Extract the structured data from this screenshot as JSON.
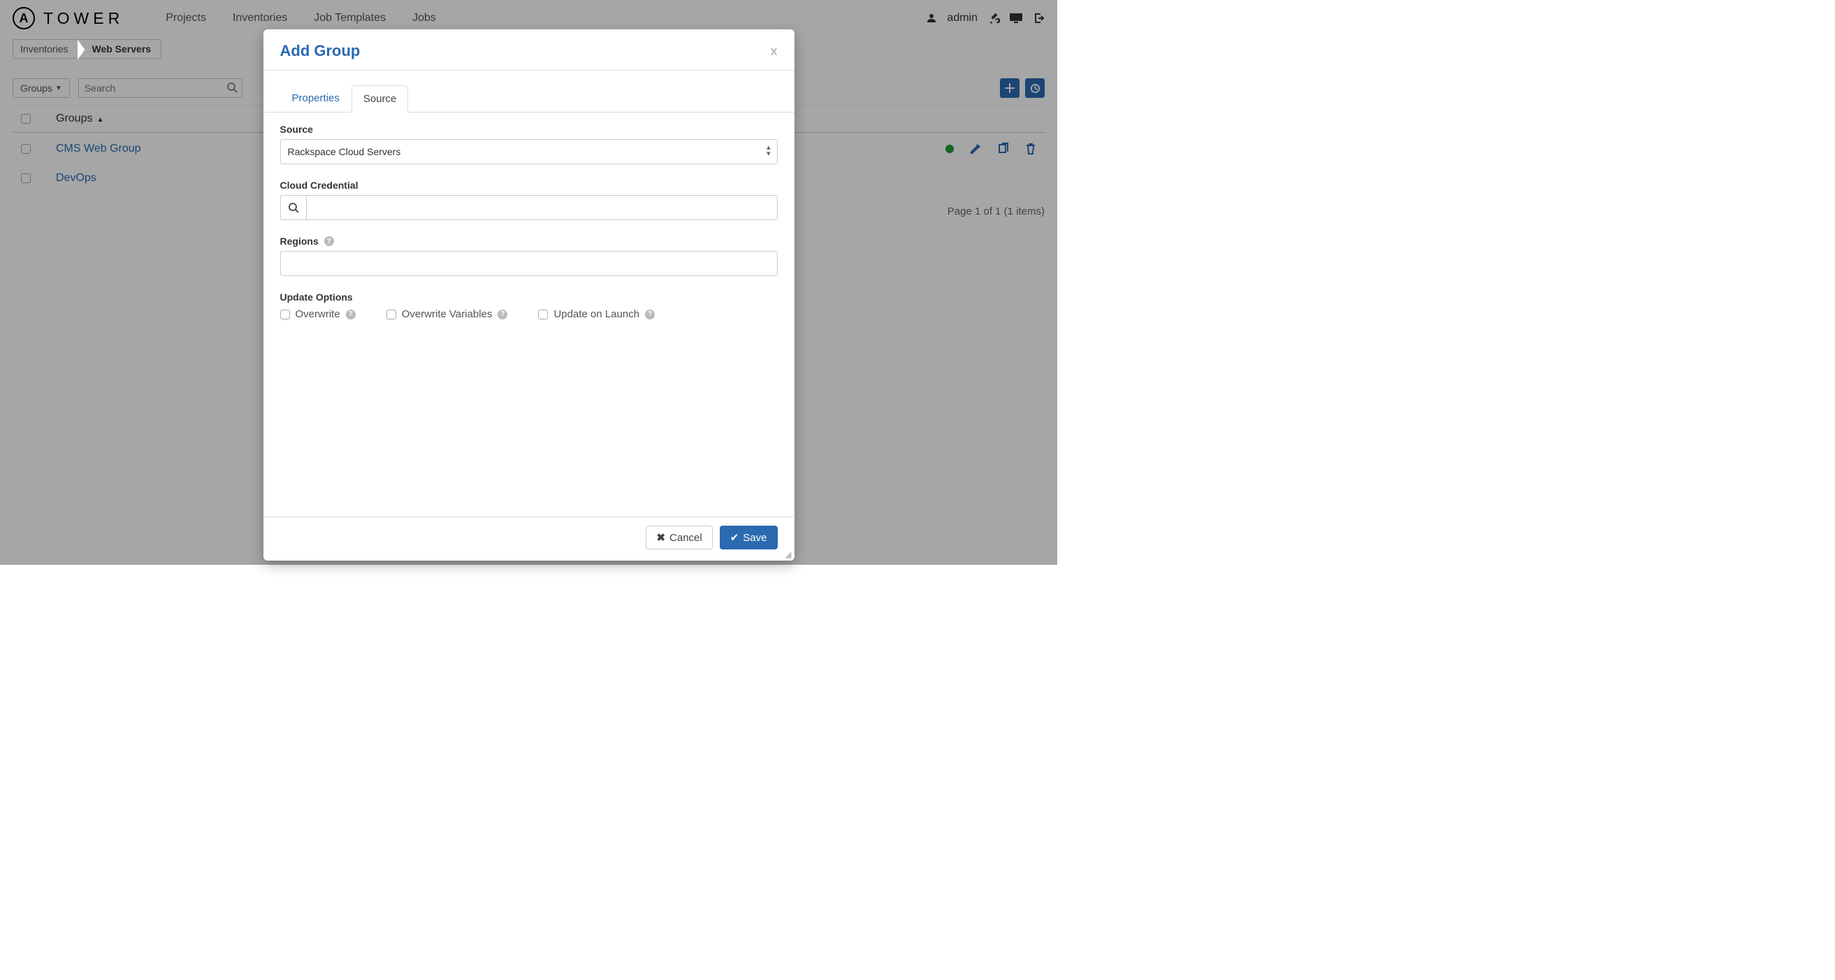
{
  "brand": {
    "text": "TOWER",
    "glyph": "A"
  },
  "nav": {
    "projects": "Projects",
    "inventories": "Inventories",
    "job_templates": "Job Templates",
    "jobs": "Jobs"
  },
  "user": {
    "name": "admin"
  },
  "breadcrumb": [
    "Inventories",
    "Web Servers"
  ],
  "toolbar": {
    "groups_label": "Groups",
    "search_placeholder": "Search"
  },
  "table": {
    "col_groups": "Groups",
    "rows": [
      {
        "name": "CMS Web Group",
        "status": "green",
        "has_actions": true
      },
      {
        "name": "DevOps",
        "status": null,
        "has_actions": false
      }
    ],
    "pager": "Page 1 of 1 (1 items)"
  },
  "modal": {
    "title": "Add Group",
    "tabs": {
      "properties": "Properties",
      "source": "Source"
    },
    "labels": {
      "source": "Source",
      "cloud_credential": "Cloud Credential",
      "regions": "Regions",
      "update_options": "Update Options",
      "overwrite": "Overwrite",
      "overwrite_vars": "Overwrite Variables",
      "update_on_launch": "Update on Launch"
    },
    "source_value": "Rackspace Cloud Servers",
    "cred_value": "",
    "regions_value": "",
    "buttons": {
      "cancel": "Cancel",
      "save": "Save"
    }
  }
}
